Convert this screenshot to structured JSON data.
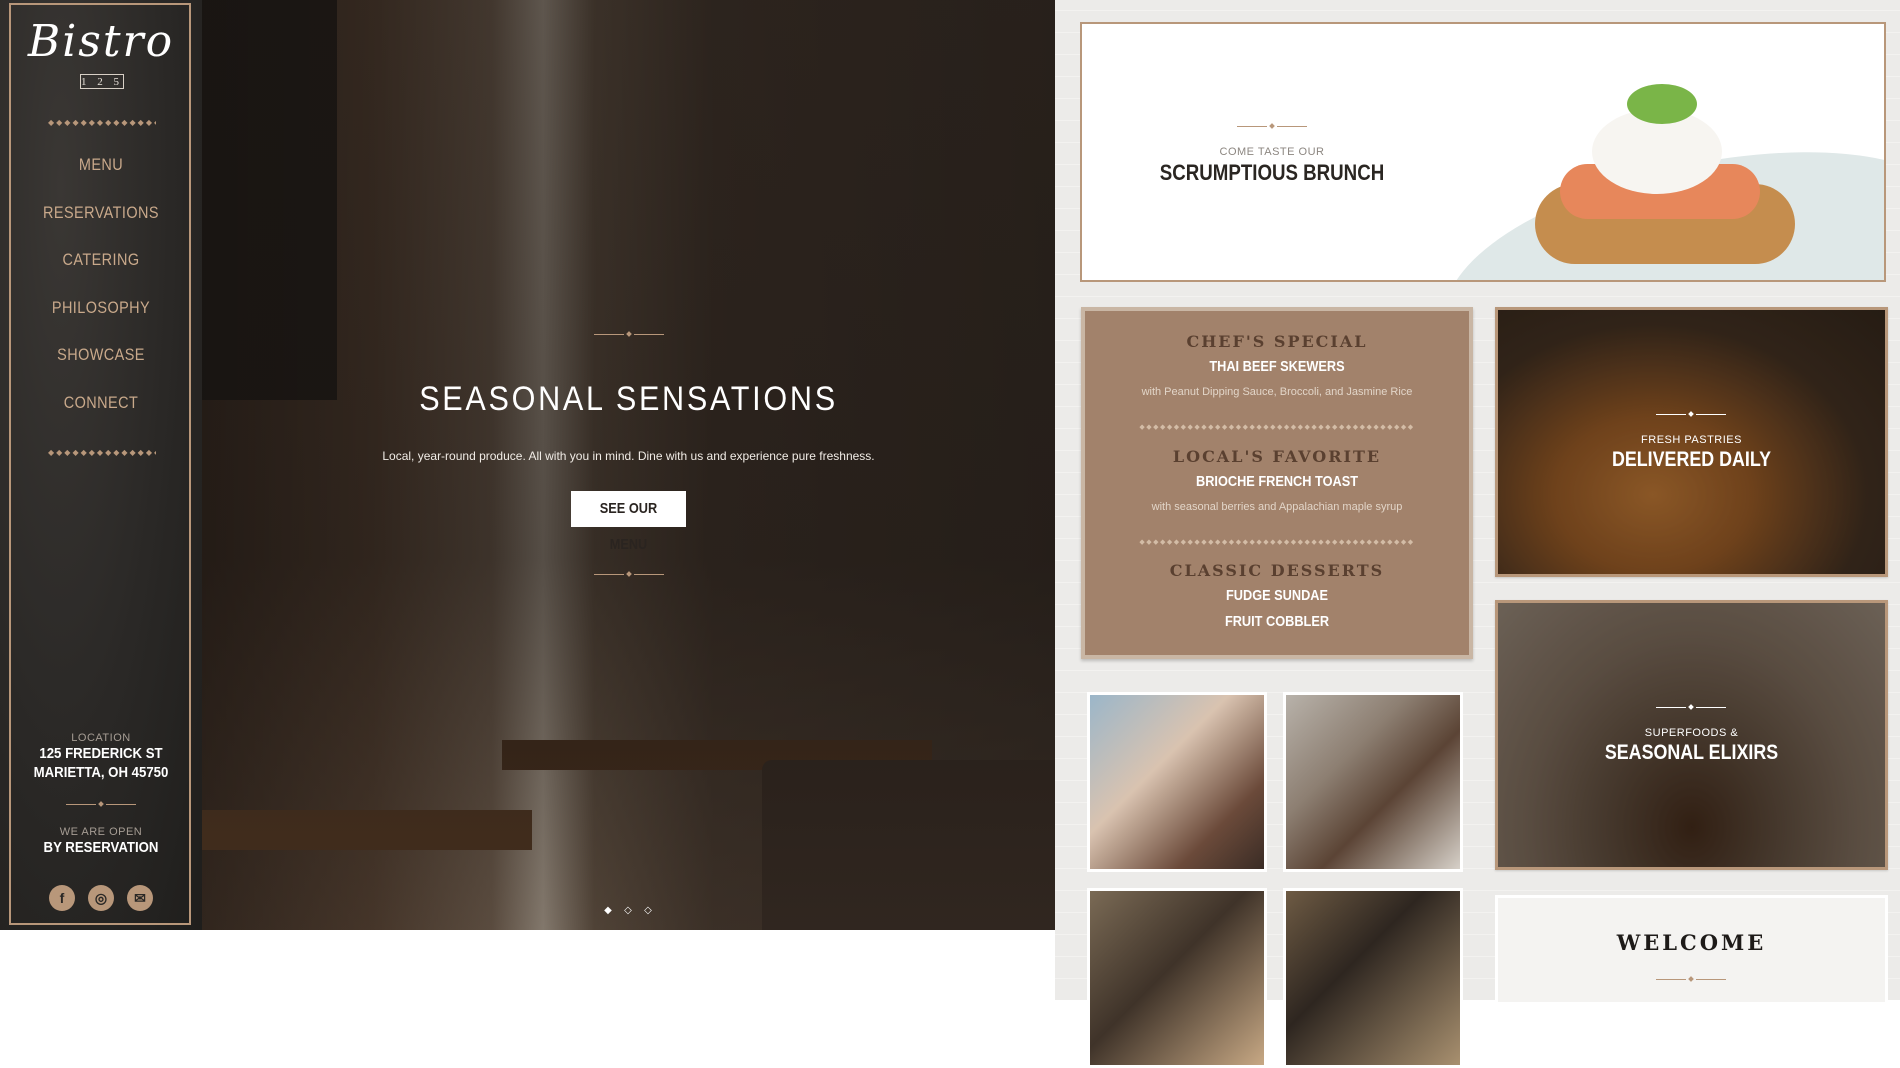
{
  "brand": {
    "name": "Bistro",
    "number": "1 2 5"
  },
  "nav": {
    "items": [
      {
        "label": "MENU"
      },
      {
        "label": "RESERVATIONS"
      },
      {
        "label": "CATERING"
      },
      {
        "label": "PHILOSOPHY"
      },
      {
        "label": "SHOWCASE"
      },
      {
        "label": "CONNECT"
      }
    ]
  },
  "sidebar": {
    "location_label": "LOCATION",
    "address_line1": "125 FREDERICK ST",
    "address_line2": "MARIETTA, OH 45750",
    "hours_label": "WE ARE OPEN",
    "hours_value": "BY RESERVATION",
    "social": [
      {
        "icon": "facebook-icon",
        "glyph": "f"
      },
      {
        "icon": "instagram-icon",
        "glyph": "◎"
      },
      {
        "icon": "email-icon",
        "glyph": "✉"
      }
    ]
  },
  "hero": {
    "title": "SEASONAL SENSATIONS",
    "subtitle": "Local, year-round produce. All with you in mind. Dine with us and experience pure freshness.",
    "button": "SEE OUR MENU",
    "slide_count": 3,
    "active_slide": 1
  },
  "cards": {
    "brunch": {
      "small": "COME TASTE OUR",
      "big": "SCRUMPTIOUS BRUNCH"
    },
    "specials": [
      {
        "heading": "CHEF'S SPECIAL",
        "items": [
          "THAI BEEF SKEWERS"
        ],
        "desc": "with Peanut Dipping Sauce, Broccoli, and Jasmine Rice"
      },
      {
        "heading": "LOCAL'S FAVORITE",
        "items": [
          "BRIOCHE FRENCH TOAST"
        ],
        "desc": "with seasonal berries and Appalachian maple syrup"
      },
      {
        "heading": "CLASSIC DESSERTS",
        "items": [
          "FUDGE SUNDAE",
          "FRUIT COBBLER"
        ],
        "desc": ""
      }
    ],
    "pastry": {
      "small": "FRESH PASTRIES",
      "big": "DELIVERED DAILY"
    },
    "elixir": {
      "small": "SUPERFOODS &",
      "big": "SEASONAL ELIXIRS"
    },
    "welcome": {
      "title": "WELCOME"
    }
  },
  "colors": {
    "accent": "#b8977a",
    "sidebar_bg": "#2a2826",
    "specials_bg": "#a2826b"
  }
}
